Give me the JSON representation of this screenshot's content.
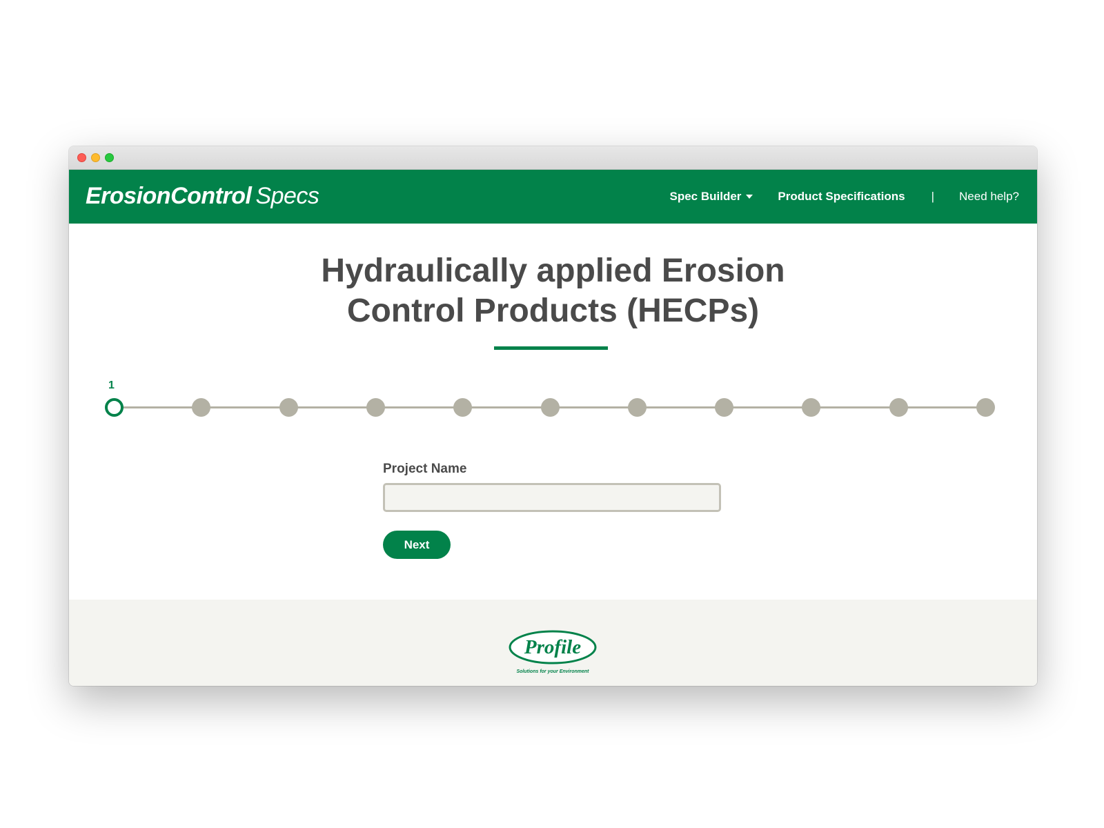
{
  "brand": {
    "part1": "ErosionControl",
    "part2": "Specs"
  },
  "nav": {
    "spec_builder": "Spec Builder",
    "product_specifications": "Product Specifications",
    "separator": "|",
    "need_help": "Need help?"
  },
  "page": {
    "title_line1": "Hydraulically applied Erosion",
    "title_line2": "Control Products (HECPs)"
  },
  "stepper": {
    "current_step_label": "1",
    "total_steps": 11,
    "current_step": 1
  },
  "form": {
    "project_name_label": "Project Name",
    "project_name_value": "",
    "next_label": "Next"
  },
  "footer": {
    "logo_name": "Profile",
    "logo_tagline": "Solutions for your Environment"
  },
  "colors": {
    "brand_green": "#02824a",
    "heading_gray": "#4a4a4a",
    "step_inactive": "#b3b1a4",
    "footer_bg": "#f4f4f0"
  }
}
